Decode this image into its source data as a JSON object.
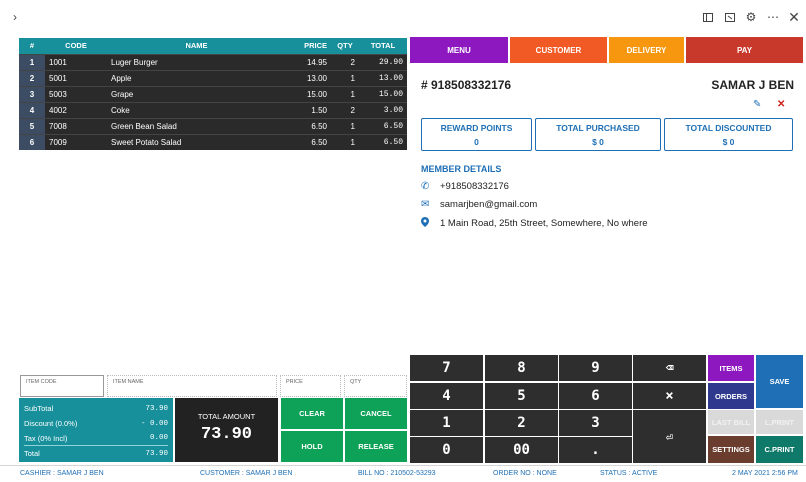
{
  "titlebar": {
    "expand_icon": "chevron-right-icon",
    "icons": [
      "window-icon",
      "calendar-icon",
      "gear-icon",
      "ellipsis-icon",
      "close-icon"
    ]
  },
  "table": {
    "headers": [
      "#",
      "CODE",
      "NAME",
      "PRICE",
      "QTY",
      "TOTAL"
    ],
    "rows": [
      {
        "num": "1",
        "code": "1001",
        "name": "Luger Burger",
        "price": "14.95",
        "qty": "2",
        "total": "29.90"
      },
      {
        "num": "2",
        "code": "5001",
        "name": "Apple",
        "price": "13.00",
        "qty": "1",
        "total": "13.00"
      },
      {
        "num": "3",
        "code": "5003",
        "name": "Grape",
        "price": "15.00",
        "qty": "1",
        "total": "15.00"
      },
      {
        "num": "4",
        "code": "4002",
        "name": "Coke",
        "price": "1.50",
        "qty": "2",
        "total": "3.00"
      },
      {
        "num": "5",
        "code": "7008",
        "name": "Green Bean Salad",
        "price": "6.50",
        "qty": "1",
        "total": "6.50"
      },
      {
        "num": "6",
        "code": "7009",
        "name": "Sweet Potato Salad",
        "price": "6.50",
        "qty": "1",
        "total": "6.50"
      }
    ]
  },
  "tabs": {
    "menu": "MENU",
    "customer": "CUSTOMER",
    "delivery": "DELIVERY",
    "pay": "PAY"
  },
  "customer": {
    "phone_header": "# 918508332176",
    "name": "SAMAR J BEN",
    "reward_label": "REWARD POINTS",
    "reward_value": "0",
    "purchased_label": "TOTAL PURCHASED",
    "purchased_value": "$ 0",
    "discounted_label": "TOTAL DISCOUNTED",
    "discounted_value": "$ 0",
    "member_title": "MEMBER DETAILS",
    "phone": "+918508332176",
    "email": "samarjben@gmail.com",
    "address": "1 Main Road, 25th Street, Somewhere, No where"
  },
  "inputs": {
    "item_code": "ITEM CODE",
    "item_name": "ITEM NAME",
    "price": "PRICE",
    "qty": "QTY"
  },
  "summary": {
    "subtotal_label": "SubTotal",
    "subtotal": "73.90",
    "discount_label": "Discount (0.0%)",
    "discount": "- 0.00",
    "tax_label": "Tax (0% Incl)",
    "tax": "0.00",
    "total_label": "Total",
    "total": "73.90",
    "total_amount_label": "TOTAL AMOUNT",
    "total_amount": "73.90"
  },
  "actions": {
    "clear": "CLEAR",
    "cancel": "CANCEL",
    "hold": "HOLD",
    "release": "RELEASE"
  },
  "keypad": {
    "k7": "7",
    "k8": "8",
    "k9": "9",
    "backspace": "⌫",
    "k4": "4",
    "k5": "5",
    "k6": "6",
    "multiply": "×",
    "k1": "1",
    "k2": "2",
    "k3": "3",
    "enter": "⏎",
    "k0": "0",
    "k00": "00",
    "dot": "."
  },
  "side_buttons": {
    "items": "ITEMS",
    "save": "SAVE",
    "orders": "ORDERS",
    "last_bill": "LAST BILL",
    "lprint": "L.PRINT",
    "settings": "SETTINGS",
    "cprint": "C.PRINT"
  },
  "status": {
    "cashier": "CASHIER : SAMAR J BEN",
    "customer": "CUSTOMER : SAMAR J BEN",
    "bill": "BILL NO : 210502-53293",
    "order": "ORDER NO : NONE",
    "state": "STATUS : ACTIVE",
    "datetime": "2 MAY 2021 2:56 PM"
  },
  "colors": {
    "teal": "#17909b",
    "menu": "#8e18bf",
    "customer": "#f15a24",
    "delivery": "#f7960f",
    "pay": "#c9392b",
    "green": "#0ea158",
    "blue": "#1e6fb5"
  }
}
